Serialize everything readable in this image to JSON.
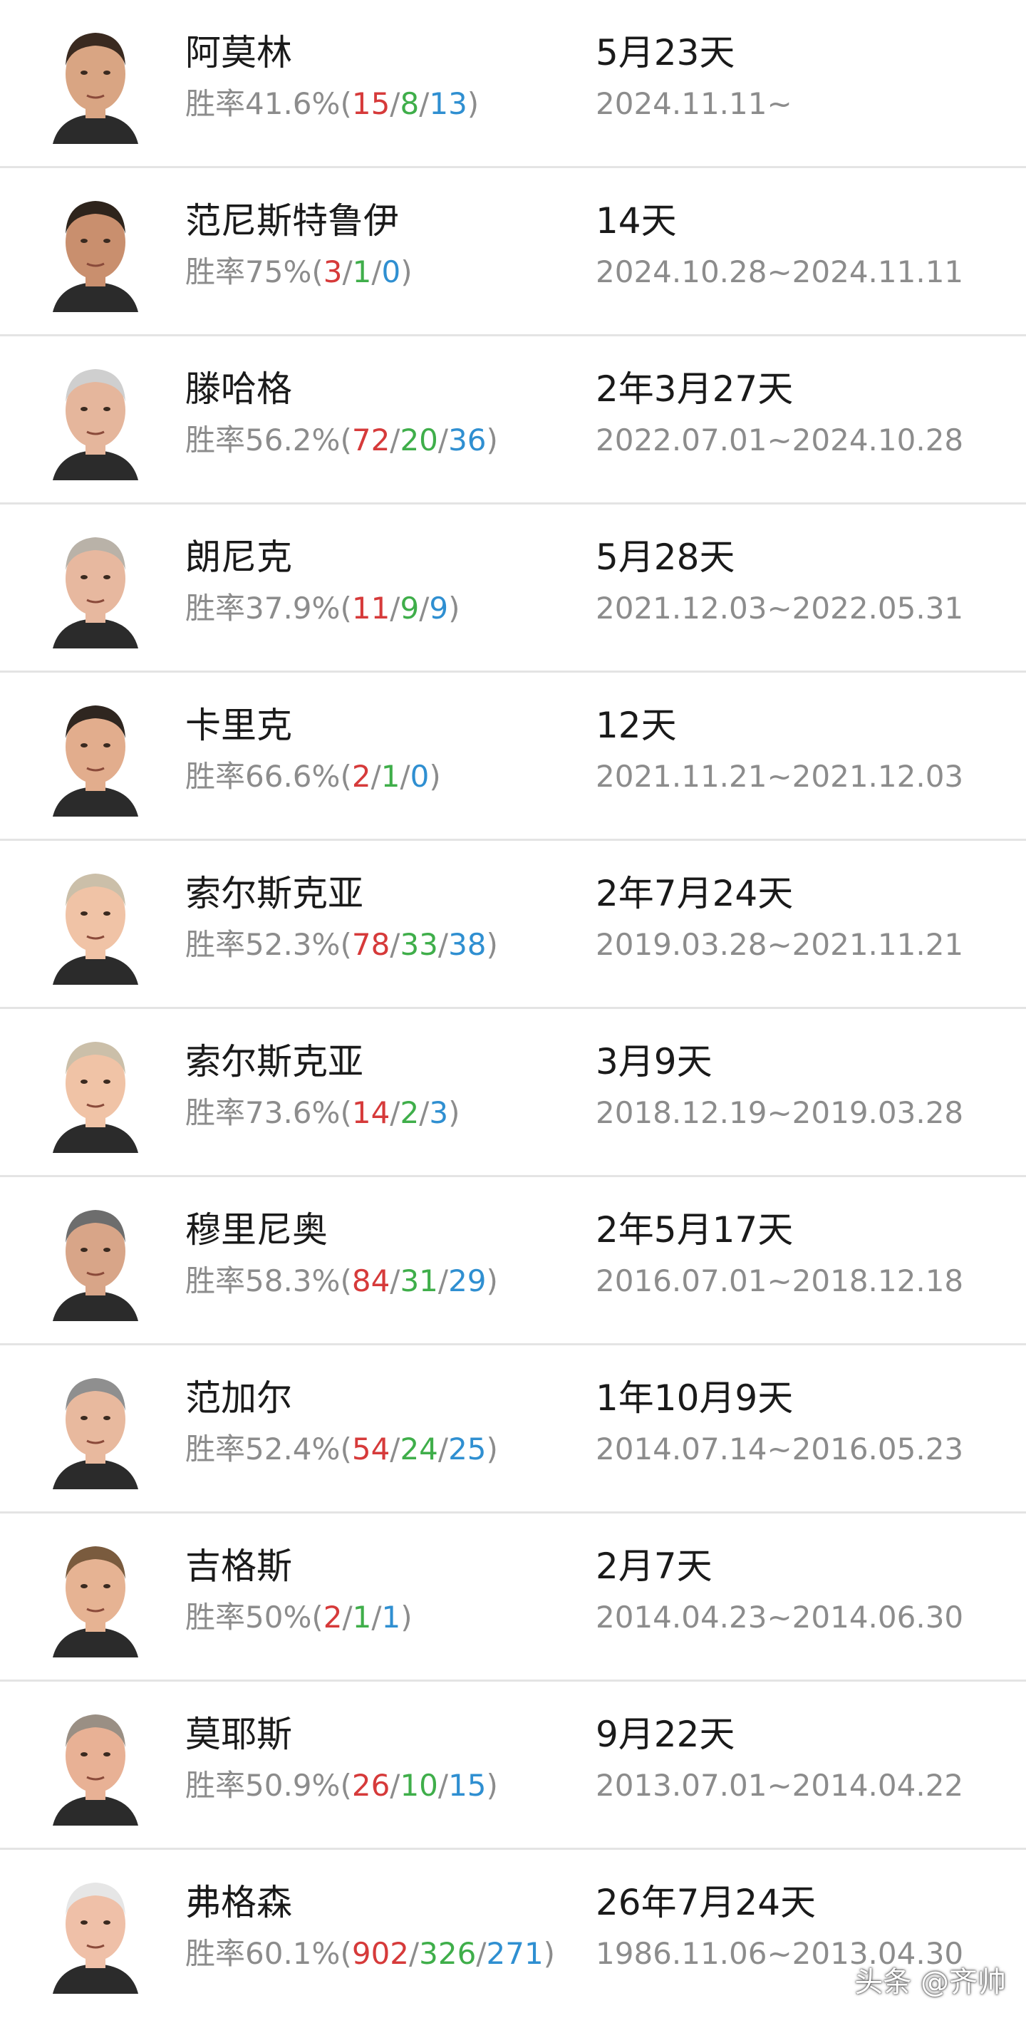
{
  "colors": {
    "win": "#d63a3a",
    "draw": "#3fae4a",
    "loss": "#2f8fd1",
    "name_text": "#1a1a1a",
    "secondary_text": "#8c8c8c"
  },
  "win_rate_label": "胜率",
  "managers": [
    {
      "name": "阿莫林",
      "rate": "41.6%",
      "w": "15",
      "d": "8",
      "l": "13",
      "duration": "5月23天",
      "period": "2024.11.11~",
      "avatar": "manager-photo-icon"
    },
    {
      "name": "范尼斯特鲁伊",
      "rate": "75%",
      "w": "3",
      "d": "1",
      "l": "0",
      "duration": "14天",
      "period": "2024.10.28~2024.11.11",
      "avatar": "manager-photo-icon"
    },
    {
      "name": "滕哈格",
      "rate": "56.2%",
      "w": "72",
      "d": "20",
      "l": "36",
      "duration": "2年3月27天",
      "period": "2022.07.01~2024.10.28",
      "avatar": "manager-photo-icon"
    },
    {
      "name": "朗尼克",
      "rate": "37.9%",
      "w": "11",
      "d": "9",
      "l": "9",
      "duration": "5月28天",
      "period": "2021.12.03~2022.05.31",
      "avatar": "manager-photo-icon"
    },
    {
      "name": "卡里克",
      "rate": "66.6%",
      "w": "2",
      "d": "1",
      "l": "0",
      "duration": "12天",
      "period": "2021.11.21~2021.12.03",
      "avatar": "manager-photo-icon"
    },
    {
      "name": "索尔斯克亚",
      "rate": "52.3%",
      "w": "78",
      "d": "33",
      "l": "38",
      "duration": "2年7月24天",
      "period": "2019.03.28~2021.11.21",
      "avatar": "manager-photo-icon"
    },
    {
      "name": "索尔斯克亚",
      "rate": "73.6%",
      "w": "14",
      "d": "2",
      "l": "3",
      "duration": "3月9天",
      "period": "2018.12.19~2019.03.28",
      "avatar": "manager-photo-icon"
    },
    {
      "name": "穆里尼奥",
      "rate": "58.3%",
      "w": "84",
      "d": "31",
      "l": "29",
      "duration": "2年5月17天",
      "period": "2016.07.01~2018.12.18",
      "avatar": "manager-photo-icon"
    },
    {
      "name": "范加尔",
      "rate": "52.4%",
      "w": "54",
      "d": "24",
      "l": "25",
      "duration": "1年10月9天",
      "period": "2014.07.14~2016.05.23",
      "avatar": "manager-photo-icon"
    },
    {
      "name": "吉格斯",
      "rate": "50%",
      "w": "2",
      "d": "1",
      "l": "1",
      "duration": "2月7天",
      "period": "2014.04.23~2014.06.30",
      "avatar": "manager-photo-icon"
    },
    {
      "name": "莫耶斯",
      "rate": "50.9%",
      "w": "26",
      "d": "10",
      "l": "15",
      "duration": "9月22天",
      "period": "2013.07.01~2014.04.22",
      "avatar": "manager-photo-icon"
    },
    {
      "name": "弗格森",
      "rate": "60.1%",
      "w": "902",
      "d": "326",
      "l": "271",
      "duration": "26年7月24天",
      "period": "1986.11.06~2013.04.30",
      "avatar": "manager-photo-icon"
    }
  ],
  "watermark": "头条 @齐帅"
}
